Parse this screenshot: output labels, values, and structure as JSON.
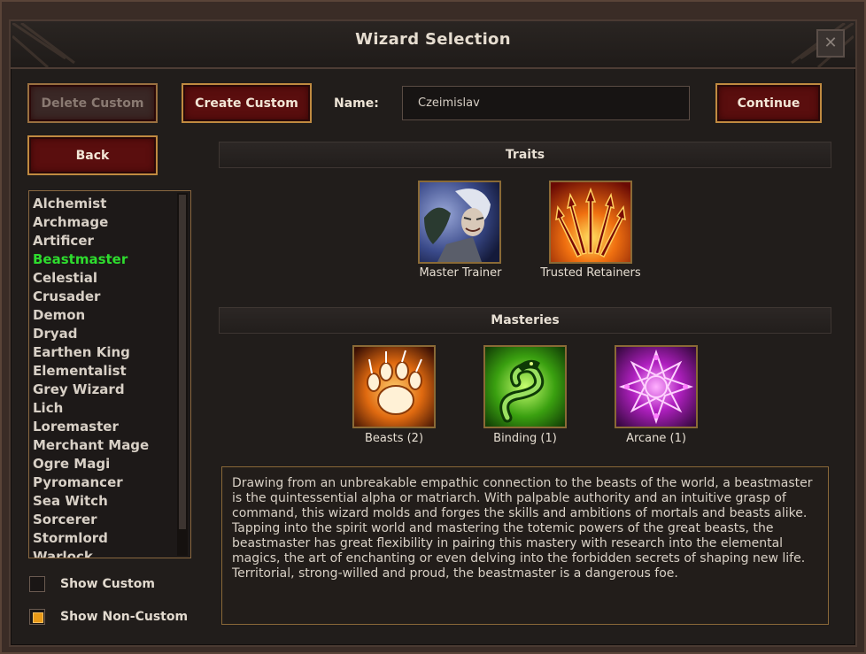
{
  "window": {
    "title": "Wizard Selection",
    "close_glyph": "✕"
  },
  "buttons": {
    "delete_custom": "Delete Custom",
    "create_custom": "Create Custom",
    "continue": "Continue",
    "back": "Back"
  },
  "name_field": {
    "label": "Name:",
    "value": "Czeimislav"
  },
  "wizard_list": {
    "selected": "Beastmaster",
    "items": [
      "Alchemist",
      "Archmage",
      "Artificer",
      "Beastmaster",
      "Celestial",
      "Crusader",
      "Demon",
      "Dryad",
      "Earthen King",
      "Elementalist",
      "Grey Wizard",
      "Lich",
      "Loremaster",
      "Merchant Mage",
      "Ogre Magi",
      "Pyromancer",
      "Sea Witch",
      "Sorcerer",
      "Stormlord",
      "Warlock"
    ]
  },
  "filters": {
    "show_custom": {
      "label": "Show Custom",
      "checked": false
    },
    "show_non_custom": {
      "label": "Show Non-Custom",
      "checked": true
    }
  },
  "traits": {
    "header": "Traits",
    "items": [
      {
        "label": "Master Trainer",
        "icon": "master-trainer-portrait-icon"
      },
      {
        "label": "Trusted Retainers",
        "icon": "trusted-retainers-spears-icon"
      }
    ]
  },
  "masteries": {
    "header": "Masteries",
    "items": [
      {
        "label": "Beasts (2)",
        "icon": "beast-paw-icon"
      },
      {
        "label": "Binding (1)",
        "icon": "binding-serpent-icon"
      },
      {
        "label": "Arcane (1)",
        "icon": "arcane-star-icon"
      }
    ]
  },
  "description": "Drawing from an unbreakable empathic connection to the beasts of the world, a beastmaster is the quintessential alpha or matriarch. With palpable authority and an intuitive grasp of command, this wizard molds and forges the skills and ambitions of mortals and beasts alike. Tapping into the spirit world and mastering the totemic powers of the great beasts, the beastmaster has great flexibility in pairing this mastery with research into the elemental magics, the art of enchanting or even delving into the forbidden secrets of shaping new life. Territorial, strong-willed and proud, the beastmaster is a dangerous foe.",
  "colors": {
    "button_fill": "#5a0e0e",
    "button_border": "#c08a40",
    "selected_item": "#2edc2e",
    "checkbox_checked": "#e89a18"
  }
}
